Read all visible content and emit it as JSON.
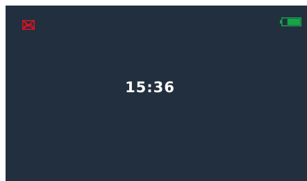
{
  "device": {
    "time": "15:36",
    "background_color": "#222f3e",
    "time_color": "#ffffff"
  },
  "status_icons": {
    "left": {
      "name": "image-disabled-icon",
      "color": "#e0121e"
    },
    "right": {
      "name": "battery-icon",
      "color": "#16a34a",
      "charge_fraction": 0.7
    }
  }
}
